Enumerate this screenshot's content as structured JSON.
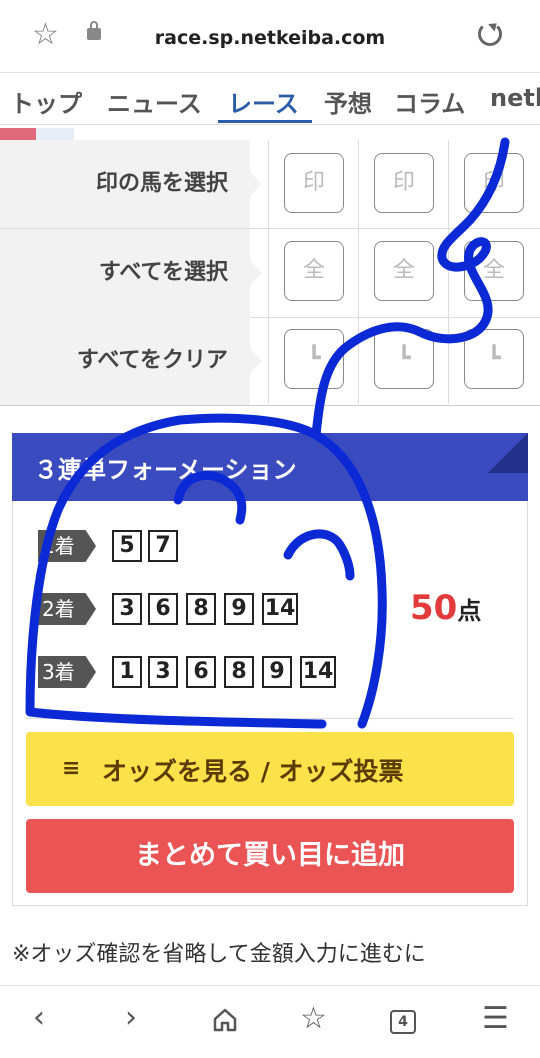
{
  "browser": {
    "url": "race.sp.netkeiba.com",
    "bookmark_icon": "star-outline-icon",
    "lock_icon": "lock-icon",
    "reload_icon": "reload-icon"
  },
  "nav": {
    "tabs": [
      "トップ",
      "ニュース",
      "レース",
      "予想",
      "コラム",
      "netk"
    ],
    "active": "レース"
  },
  "selection": {
    "rows": [
      {
        "label": "印の馬を選択",
        "button": "印"
      },
      {
        "label": "すべてを選択",
        "button": "全"
      },
      {
        "label": "すべてをクリア",
        "button": "┗"
      }
    ]
  },
  "formation": {
    "title": "３連単フォーメーション",
    "rows": [
      {
        "tag": "1着",
        "numbers": [
          "5",
          "7"
        ]
      },
      {
        "tag": "2着",
        "numbers": [
          "3",
          "6",
          "8",
          "9",
          "14"
        ]
      },
      {
        "tag": "3着",
        "numbers": [
          "1",
          "3",
          "6",
          "8",
          "9",
          "14"
        ]
      }
    ],
    "points_value": "50",
    "points_unit": "点",
    "odds_button": "オッズを見る / オッズ投票",
    "add_button": "まとめて買い目に追加"
  },
  "note": "※オッズ確認を省略して金額入力に進むに",
  "toolbar": {
    "back_icon": "back-icon",
    "forward_icon": "forward-icon",
    "home_icon": "home-icon",
    "bookmarks_icon": "bookmarks-icon",
    "tab_count": "4",
    "menu_icon": "menu-icon"
  },
  "colors": {
    "accent_blue": "#2a5ca8",
    "header_blue": "#3a4bc0",
    "points_red": "#e33b3b",
    "odds_yellow": "#fbe14a",
    "add_red": "#ea5454",
    "scribble_blue": "#0b2ad6"
  }
}
